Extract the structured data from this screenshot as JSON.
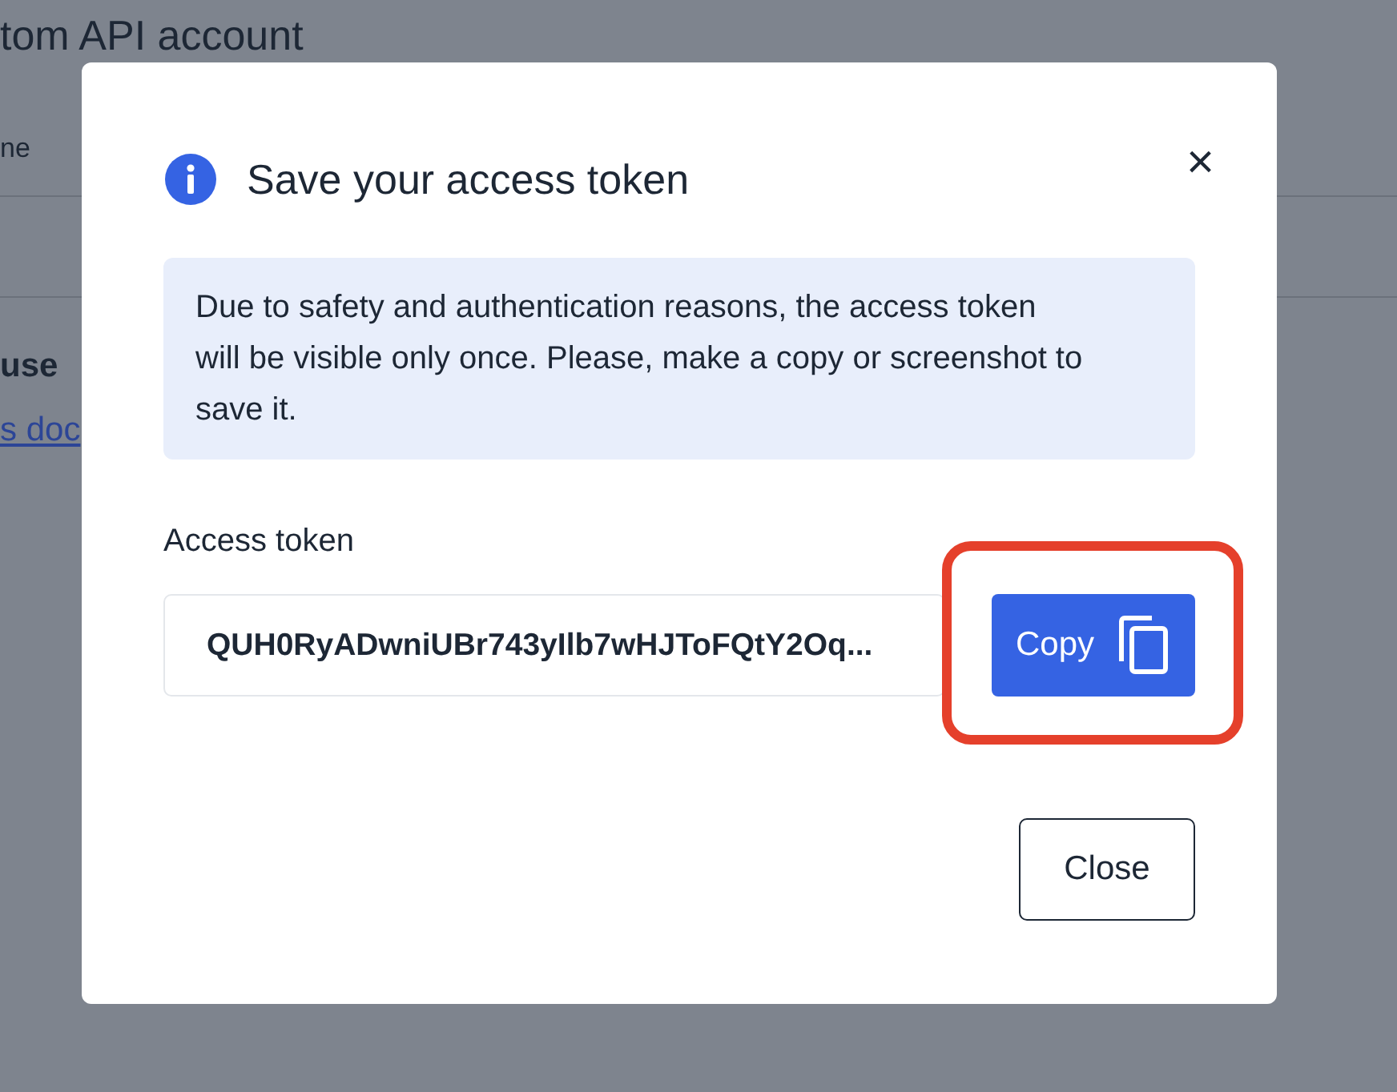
{
  "background_page": {
    "title": "tom API account",
    "column_header": "ne",
    "paragraph": "use",
    "link": "s doc"
  },
  "dialog": {
    "title": "Save your access token",
    "close_glyph": "×",
    "notice": "Due to safety and authentication reasons, the access token will be visible only once. Please, make a copy or screenshot to save it.",
    "field_label": "Access token",
    "token": "QUH0RyADwniUBr743yIlb7wHJToFQtY2Oq...",
    "copy_button": "Copy",
    "copy_highlighted": true,
    "close_button": "Close"
  }
}
